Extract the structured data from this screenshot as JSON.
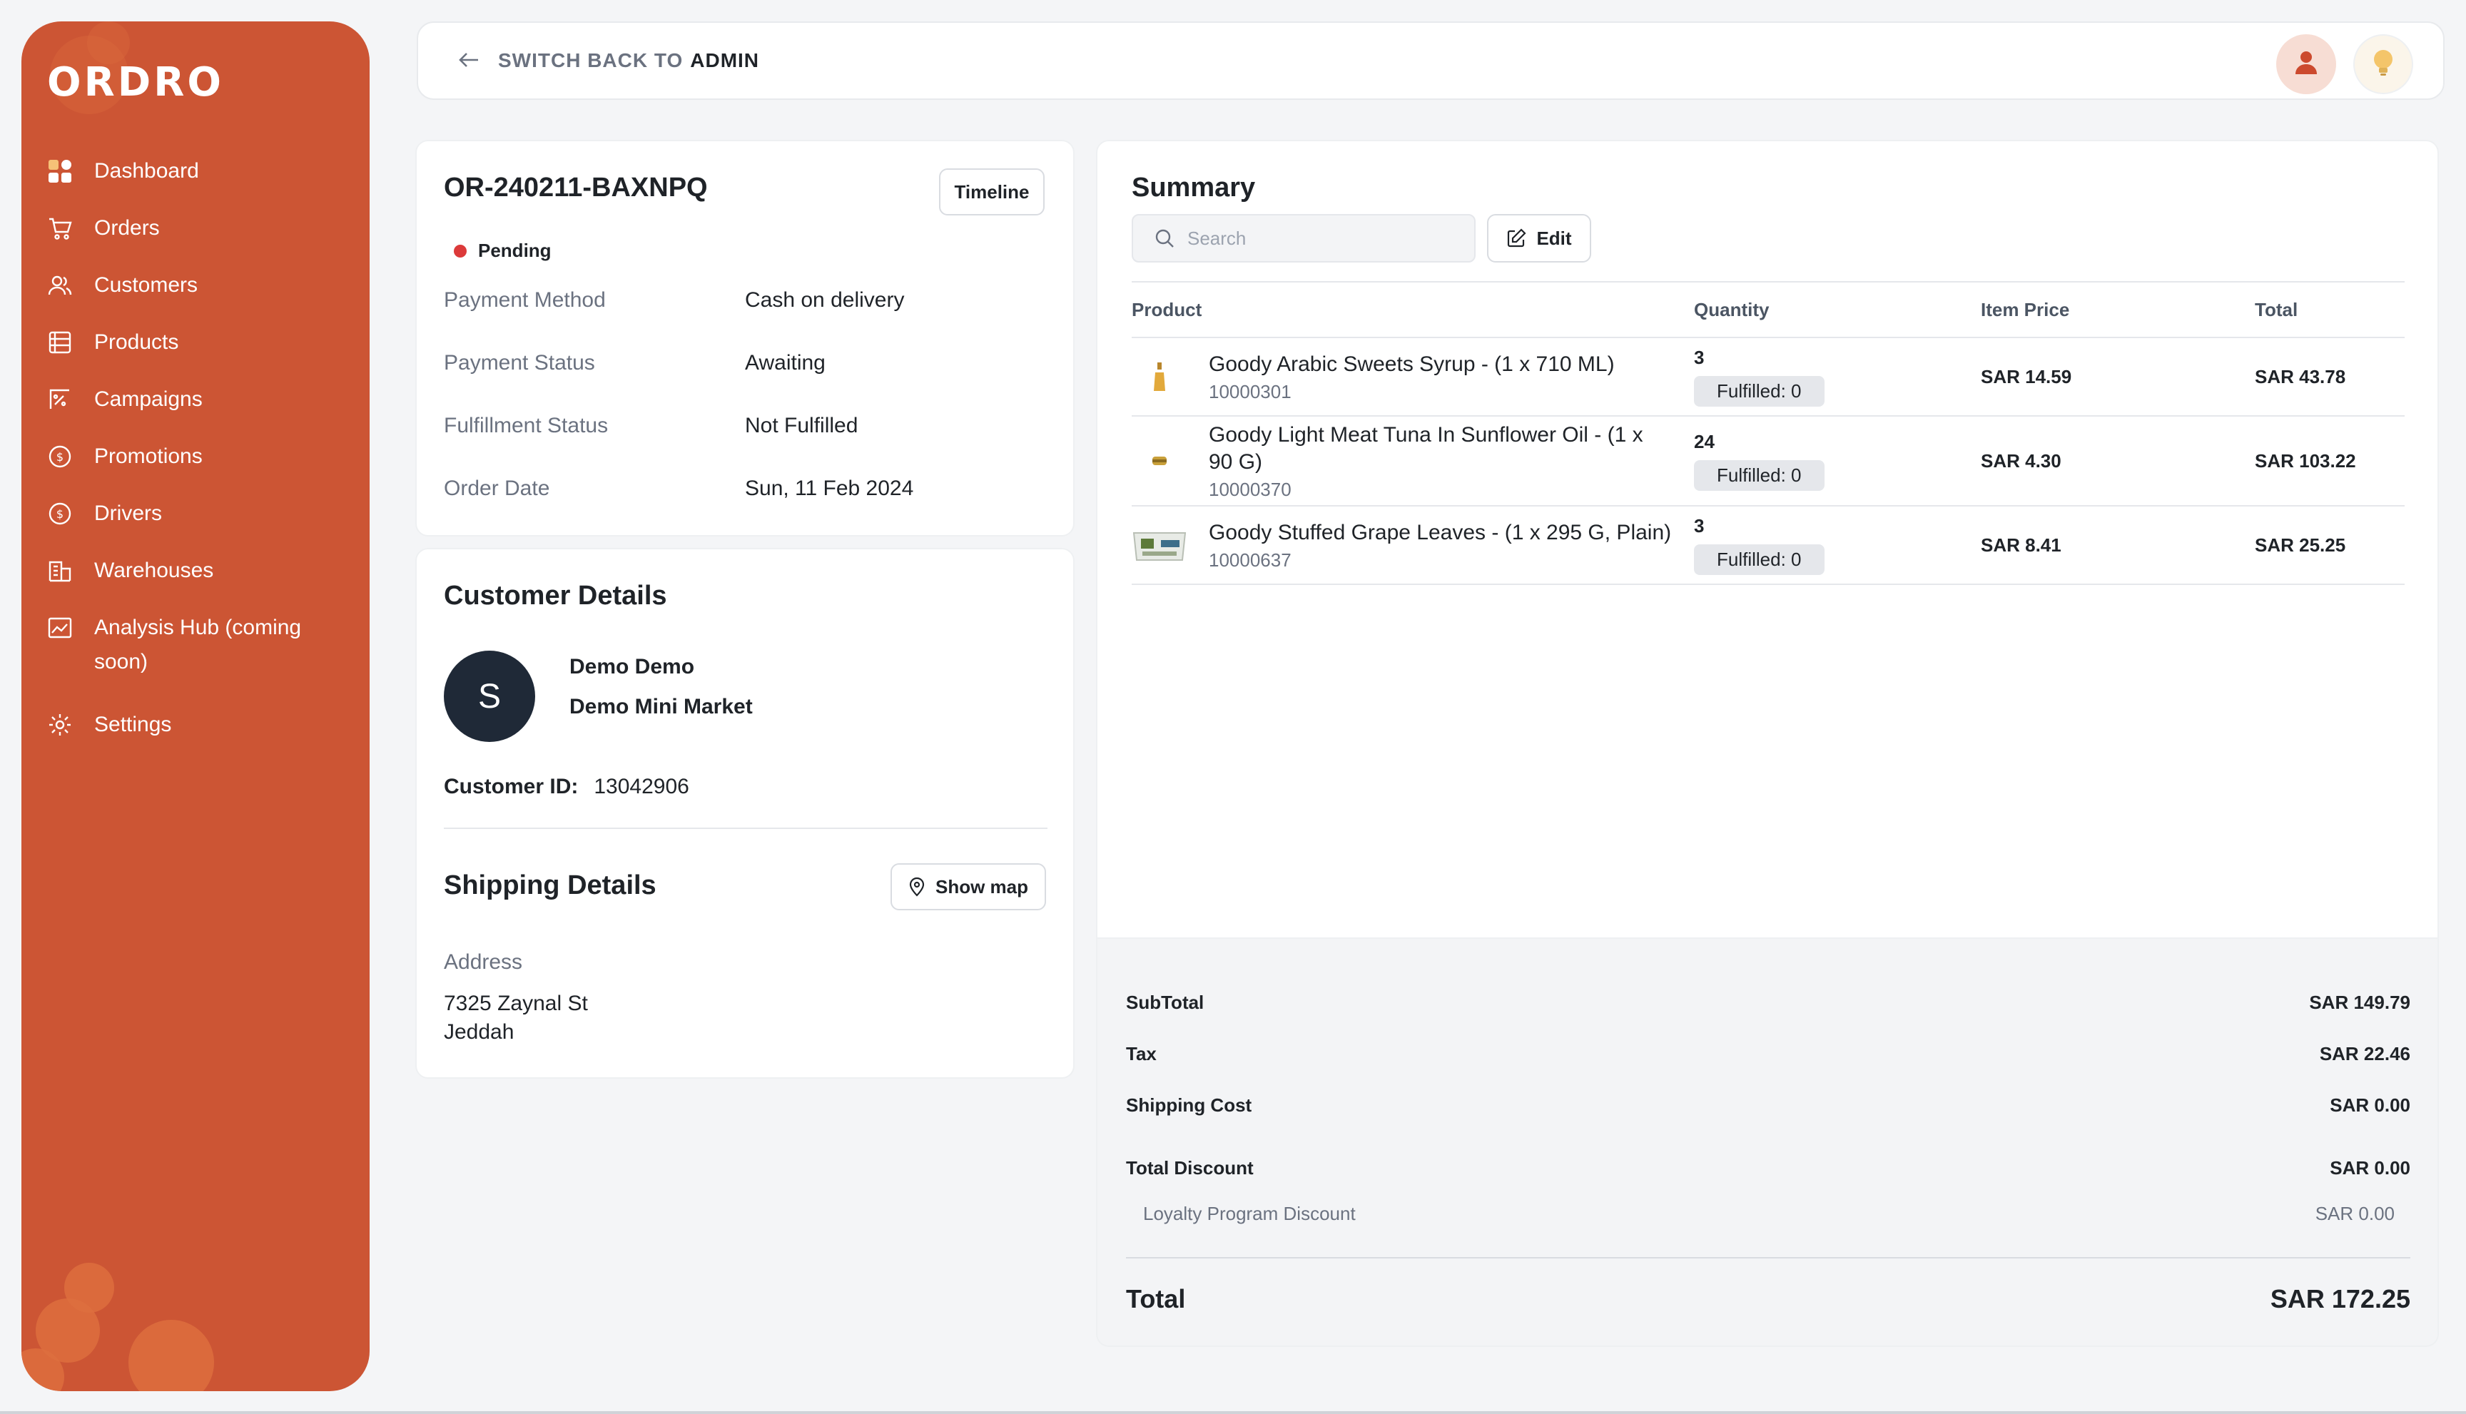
{
  "brand": {
    "logo_text": "ORDRO",
    "sidebar_color": "#cc5534",
    "accent": "#dd6e3e"
  },
  "sidebar": {
    "items": [
      {
        "label": "Dashboard",
        "icon": "dashboard-icon"
      },
      {
        "label": "Orders",
        "icon": "cart-icon"
      },
      {
        "label": "Customers",
        "icon": "users-icon"
      },
      {
        "label": "Products",
        "icon": "box-icon"
      },
      {
        "label": "Campaigns",
        "icon": "campaign-icon"
      },
      {
        "label": "Promotions",
        "icon": "coin-icon"
      },
      {
        "label": "Drivers",
        "icon": "coin-icon"
      },
      {
        "label": "Warehouses",
        "icon": "warehouse-icon"
      },
      {
        "label": "Analysis Hub (coming soon)",
        "icon": "chart-icon"
      },
      {
        "label": "Settings",
        "icon": "gear-icon"
      }
    ]
  },
  "topbar": {
    "switch_prefix": "SWITCH BACK TO",
    "switch_target": "ADMIN"
  },
  "order": {
    "id": "OR-240211-BAXNPQ",
    "timeline_label": "Timeline",
    "status": "Pending",
    "fields": [
      {
        "key": "Payment Method",
        "value": "Cash on delivery"
      },
      {
        "key": "Payment Status",
        "value": "Awaiting"
      },
      {
        "key": "Fulfillment Status",
        "value": "Not Fulfilled"
      },
      {
        "key": "Order Date",
        "value": "Sun, 11 Feb 2024"
      }
    ]
  },
  "customer": {
    "title": "Customer Details",
    "avatar_initial": "S",
    "name": "Demo Demo",
    "market": "Demo Mini Market",
    "id_label": "Customer ID:",
    "id_value": "13042906"
  },
  "shipping": {
    "title": "Shipping Details",
    "show_map_label": "Show map",
    "address_label": "Address",
    "address_line1": "7325 Zaynal St",
    "address_line2": "Jeddah"
  },
  "summary": {
    "title": "Summary",
    "search_placeholder": "Search",
    "edit_label": "Edit",
    "columns": [
      "Product",
      "Quantity",
      "Item Price",
      "Total"
    ],
    "rows": [
      {
        "name": "Goody Arabic Sweets Syrup - (1 x 710 ML)",
        "sku": "10000301",
        "qty": "3",
        "fulfilled": "Fulfilled: 0",
        "price": "SAR 14.59",
        "total": "SAR 43.78"
      },
      {
        "name": "Goody Light Meat Tuna In Sunflower Oil - (1 x 90 G)",
        "sku": "10000370",
        "qty": "24",
        "fulfilled": "Fulfilled: 0",
        "price": "SAR 4.30",
        "total": "SAR 103.22"
      },
      {
        "name": "Goody Stuffed Grape Leaves - (1 x 295 G, Plain)",
        "sku": "10000637",
        "qty": "3",
        "fulfilled": "Fulfilled: 0",
        "price": "SAR 8.41",
        "total": "SAR 25.25"
      }
    ]
  },
  "totals": {
    "subtotal_label": "SubTotal",
    "subtotal": "SAR 149.79",
    "tax_label": "Tax",
    "tax": "SAR 22.46",
    "shipping_label": "Shipping Cost",
    "shipping": "SAR 0.00",
    "discount_label": "Total Discount",
    "discount": "SAR 0.00",
    "loyalty_label": "Loyalty Program Discount",
    "loyalty": "SAR 0.00",
    "total_label": "Total",
    "total": "SAR 172.25"
  }
}
